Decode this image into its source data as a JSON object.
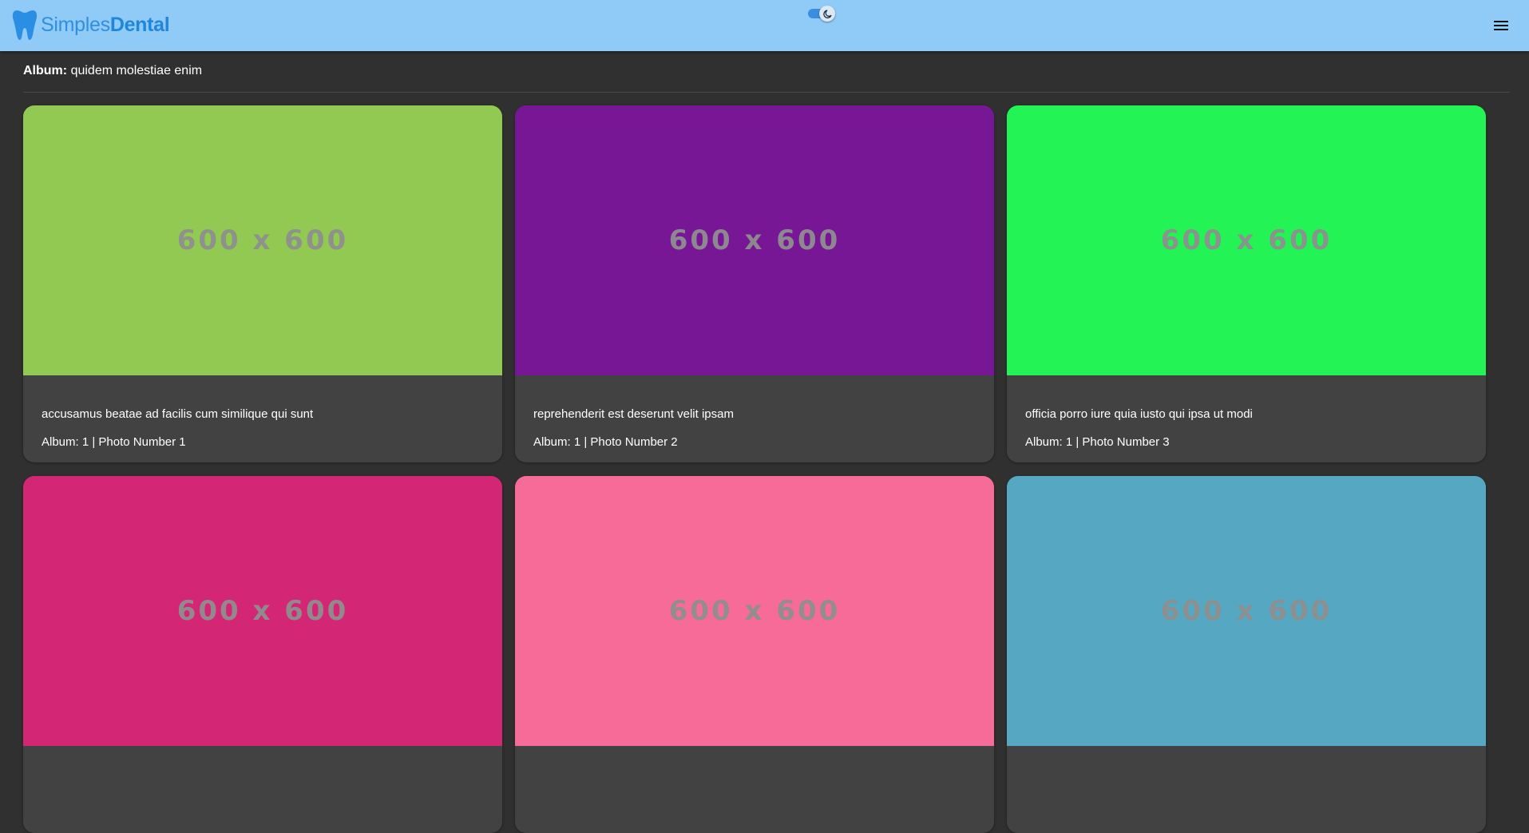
{
  "header": {
    "brand_light": "Simples",
    "brand_bold": "Dental",
    "logo_icon": "tooth-icon",
    "theme_toggle_icon": "moon-icon",
    "menu_icon": "hamburger-menu-icon",
    "colors": {
      "appbar": "#90caf6",
      "brand": "#1f86dc",
      "toggle": "#3a8de0"
    }
  },
  "album": {
    "label": "Album:",
    "title": "quidem molestiae enim"
  },
  "photos": [
    {
      "image_text": "600 x 600",
      "color": "#92c952",
      "title": "accusamus beatae ad facilis cum similique qui sunt",
      "meta": "Album: 1 | Photo Number 1"
    },
    {
      "image_text": "600 x 600",
      "color": "#771796",
      "title": "reprehenderit est deserunt velit ipsam",
      "meta": "Album: 1 | Photo Number 2"
    },
    {
      "image_text": "600 x 600",
      "color": "#24f355",
      "title": "officia porro iure quia iusto qui ipsa ut modi",
      "meta": "Album: 1 | Photo Number 3"
    },
    {
      "image_text": "600 x 600",
      "color": "#d32776",
      "title": "",
      "meta": ""
    },
    {
      "image_text": "600 x 600",
      "color": "#f66b97",
      "title": "",
      "meta": ""
    },
    {
      "image_text": "600 x 600",
      "color": "#56a8c2",
      "title": "",
      "meta": ""
    }
  ],
  "theme": {
    "background": "#303030",
    "card": "#424242",
    "text": "#ffffff"
  }
}
